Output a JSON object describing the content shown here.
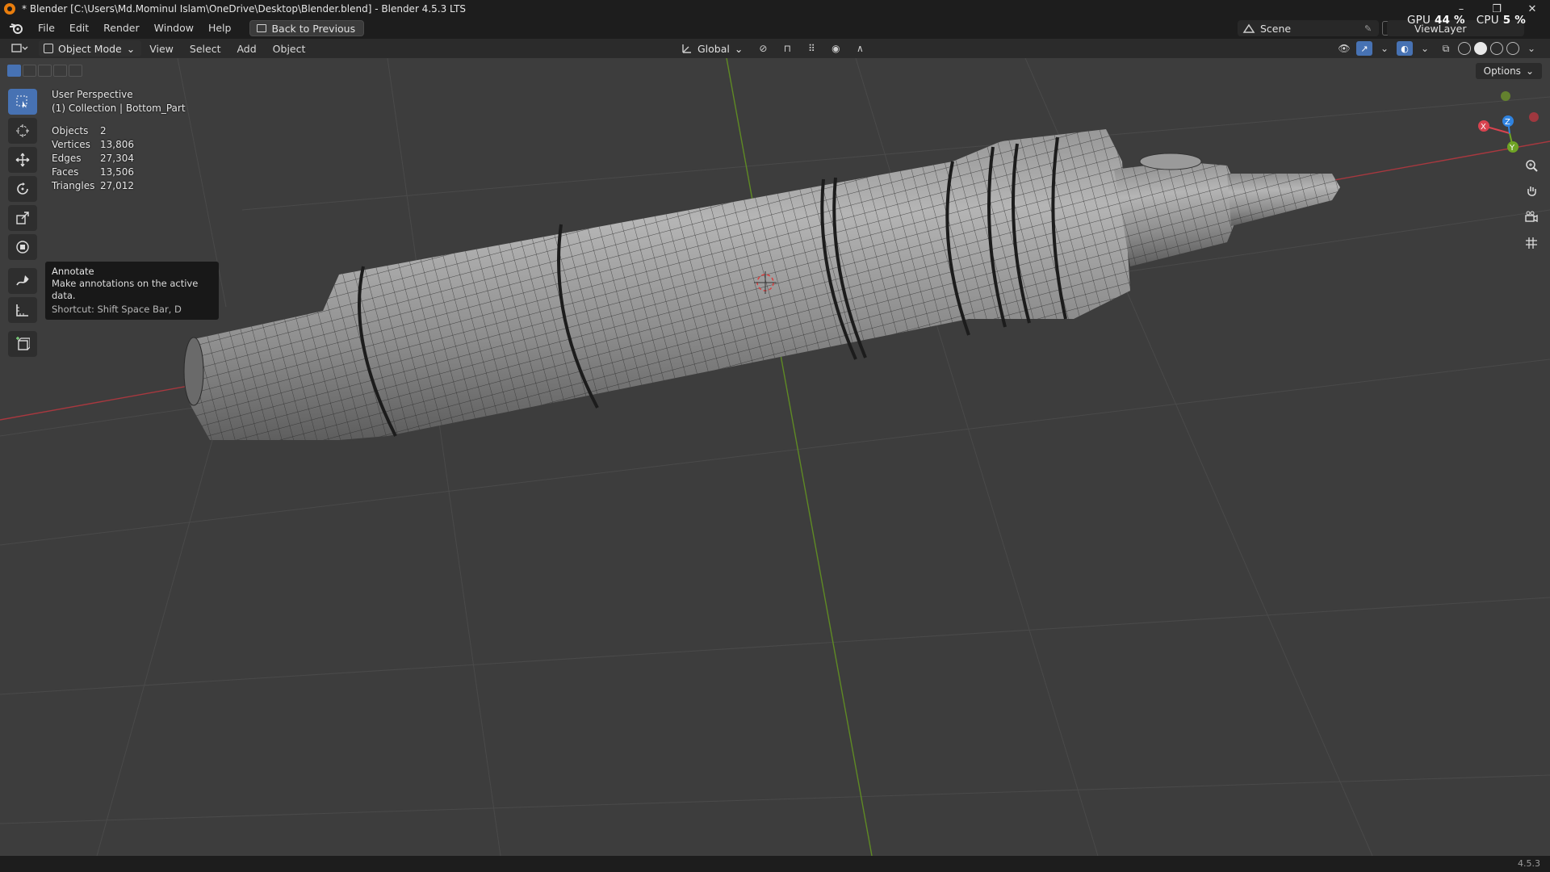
{
  "titlebar": {
    "title": "* Blender [C:\\Users\\Md.Mominul Islam\\OneDrive\\Desktop\\Blender.blend] - Blender 4.5.3 LTS",
    "minimize": "–",
    "maximize": "❐",
    "close": "✕"
  },
  "menu": {
    "items": [
      "File",
      "Edit",
      "Render",
      "Window",
      "Help"
    ],
    "back_button": "Back to Previous"
  },
  "scene": {
    "name": "Scene"
  },
  "view_layer": {
    "name": "ViewLayer"
  },
  "perf": {
    "gpu_label": "GPU",
    "gpu_value": "44 %",
    "cpu_label": "CPU",
    "cpu_value": "5 %"
  },
  "viewport_header": {
    "mode": "Object Mode",
    "menus": [
      "View",
      "Select",
      "Add",
      "Object"
    ],
    "transform_orientation": "Global",
    "options": "Options"
  },
  "overlay": {
    "perspective": "User Perspective",
    "collection": "(1) Collection | Bottom_Part"
  },
  "stats": {
    "objects_label": "Objects",
    "objects": "2",
    "vertices_label": "Vertices",
    "vertices": "13,806",
    "edges_label": "Edges",
    "edges": "27,304",
    "faces_label": "Faces",
    "faces": "13,506",
    "triangles_label": "Triangles",
    "triangles": "27,012"
  },
  "tooltip": {
    "title": "Annotate",
    "description": "Make annotations on the active data.",
    "shortcut": "Shortcut: Shift Space Bar, D"
  },
  "gizmo": {
    "x": "X",
    "y": "Y",
    "z": "Z"
  },
  "status": {
    "version": "4.5.3"
  },
  "icons": {
    "app": "blender-icon",
    "tools": [
      "select-box-icon",
      "cursor-icon",
      "move-icon",
      "rotate-icon",
      "scale-icon",
      "transform-icon",
      "annotate-icon",
      "measure-icon",
      "add-cube-icon"
    ],
    "nav": [
      "zoom-icon",
      "pan-icon",
      "camera-icon",
      "ortho-grid-icon"
    ]
  },
  "colors": {
    "accent": "#4772b3",
    "x_axis": "#d9434f",
    "y_axis": "#6fa425",
    "z_axis": "#2f83e0"
  }
}
